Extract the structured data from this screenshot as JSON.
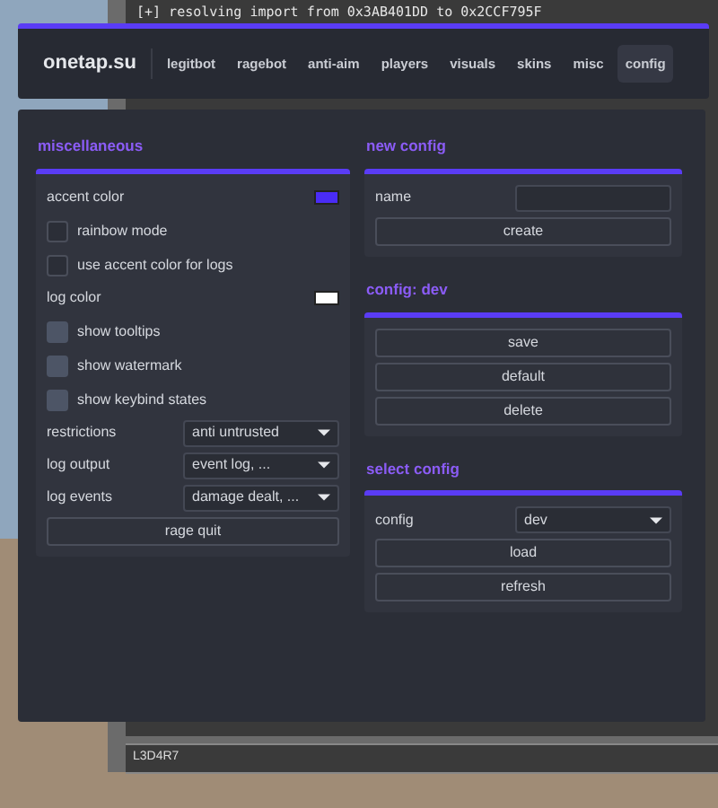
{
  "console": {
    "lines": [
      "[+] resolving import from 0x3AB401DD to 0x2CCF795F"
    ],
    "input": "L3D4R7"
  },
  "header": {
    "brand": "onetap.su",
    "tabs": [
      {
        "label": "legitbot",
        "selected": false
      },
      {
        "label": "ragebot",
        "selected": false
      },
      {
        "label": "anti-aim",
        "selected": false
      },
      {
        "label": "players",
        "selected": false
      },
      {
        "label": "visuals",
        "selected": false
      },
      {
        "label": "skins",
        "selected": false
      },
      {
        "label": "misc",
        "selected": false
      },
      {
        "label": "config",
        "selected": true
      }
    ]
  },
  "columns": [
    [
      {
        "title": "miscellaneous",
        "items": [
          {
            "kind": "color",
            "label": "accent color",
            "color": "#4a2cf5"
          },
          {
            "kind": "checkbox",
            "label": "rainbow mode",
            "checked": false
          },
          {
            "kind": "checkbox",
            "label": "use accent color for logs",
            "checked": false
          },
          {
            "kind": "color",
            "label": "log color",
            "color": "#ffffff"
          },
          {
            "kind": "checkbox",
            "label": "show tooltips",
            "checked": true
          },
          {
            "kind": "checkbox",
            "label": "show watermark",
            "checked": true
          },
          {
            "kind": "checkbox",
            "label": "show keybind states",
            "checked": true
          },
          {
            "kind": "select",
            "label": "restrictions",
            "value": "anti untrusted"
          },
          {
            "kind": "select",
            "label": "log output",
            "value": "event log, ..."
          },
          {
            "kind": "select",
            "label": "log events",
            "value": "damage dealt, ..."
          },
          {
            "kind": "button",
            "label": "rage quit"
          }
        ]
      }
    ],
    [
      {
        "title": "new config",
        "items": [
          {
            "kind": "field",
            "label": "name"
          },
          {
            "kind": "button",
            "label": "create"
          }
        ]
      },
      {
        "title": "config: dev",
        "items": [
          {
            "kind": "button",
            "label": "save"
          },
          {
            "kind": "button",
            "label": "default"
          },
          {
            "kind": "button",
            "label": "delete"
          }
        ]
      },
      {
        "title": "select config",
        "items": [
          {
            "kind": "select",
            "label": "config",
            "value": "dev"
          },
          {
            "kind": "button",
            "label": "load"
          },
          {
            "kind": "button",
            "label": "refresh"
          }
        ]
      }
    ]
  ]
}
